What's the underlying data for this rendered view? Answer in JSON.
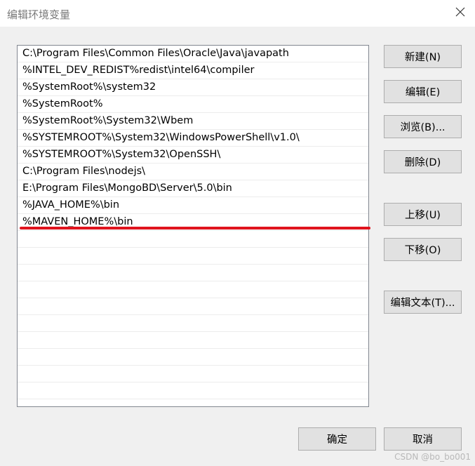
{
  "window": {
    "title": "编辑环境变量",
    "close_icon": "close-icon"
  },
  "path_list": {
    "items": [
      "C:\\Program Files\\Common Files\\Oracle\\Java\\javapath",
      "%INTEL_DEV_REDIST%redist\\intel64\\compiler",
      "%SystemRoot%\\system32",
      "%SystemRoot%",
      "%SystemRoot%\\System32\\Wbem",
      "%SYSTEMROOT%\\System32\\WindowsPowerShell\\v1.0\\",
      "%SYSTEMROOT%\\System32\\OpenSSH\\",
      "C:\\Program Files\\nodejs\\",
      "E:\\Program Files\\MongoBD\\Server\\5.0\\bin",
      "%JAVA_HOME%\\bin",
      "%MAVEN_HOME%\\bin"
    ],
    "highlight_color": "#e0141e"
  },
  "buttons": {
    "new": "新建(N)",
    "edit": "编辑(E)",
    "browse": "浏览(B)...",
    "delete": "删除(D)",
    "move_up": "上移(U)",
    "move_down": "下移(O)",
    "edit_text": "编辑文本(T)...",
    "ok": "确定",
    "cancel": "取消"
  },
  "watermark": "CSDN @bo_bo001"
}
